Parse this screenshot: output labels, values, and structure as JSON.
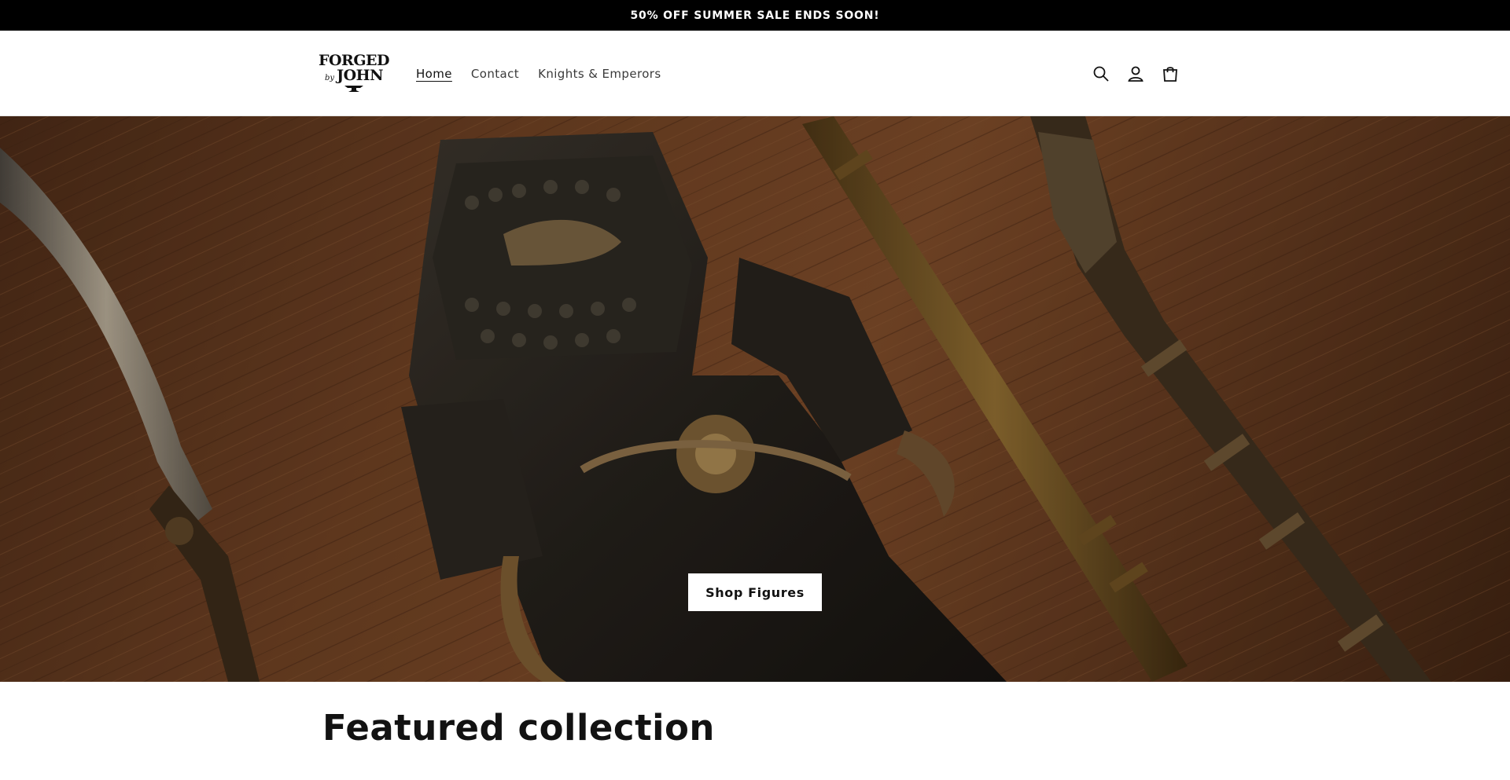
{
  "announcement": {
    "text": "50% OFF SUMMER SALE ENDS SOON!"
  },
  "header": {
    "logo": {
      "line1": "FORGED",
      "by": "by",
      "line3": "JOHN"
    },
    "nav": [
      {
        "label": "Home",
        "active": true
      },
      {
        "label": "Contact",
        "active": false
      },
      {
        "label": "Knights & Emperors",
        "active": false
      }
    ],
    "icons": [
      "search-icon",
      "account-icon",
      "cart-icon"
    ]
  },
  "hero": {
    "button_label": "Shop Figures"
  },
  "featured": {
    "heading": "Featured collection"
  },
  "colors": {
    "announcement_bg": "#000000",
    "text": "#121212",
    "hero_wood": "#6b3f22",
    "button_bg": "#ffffff"
  }
}
